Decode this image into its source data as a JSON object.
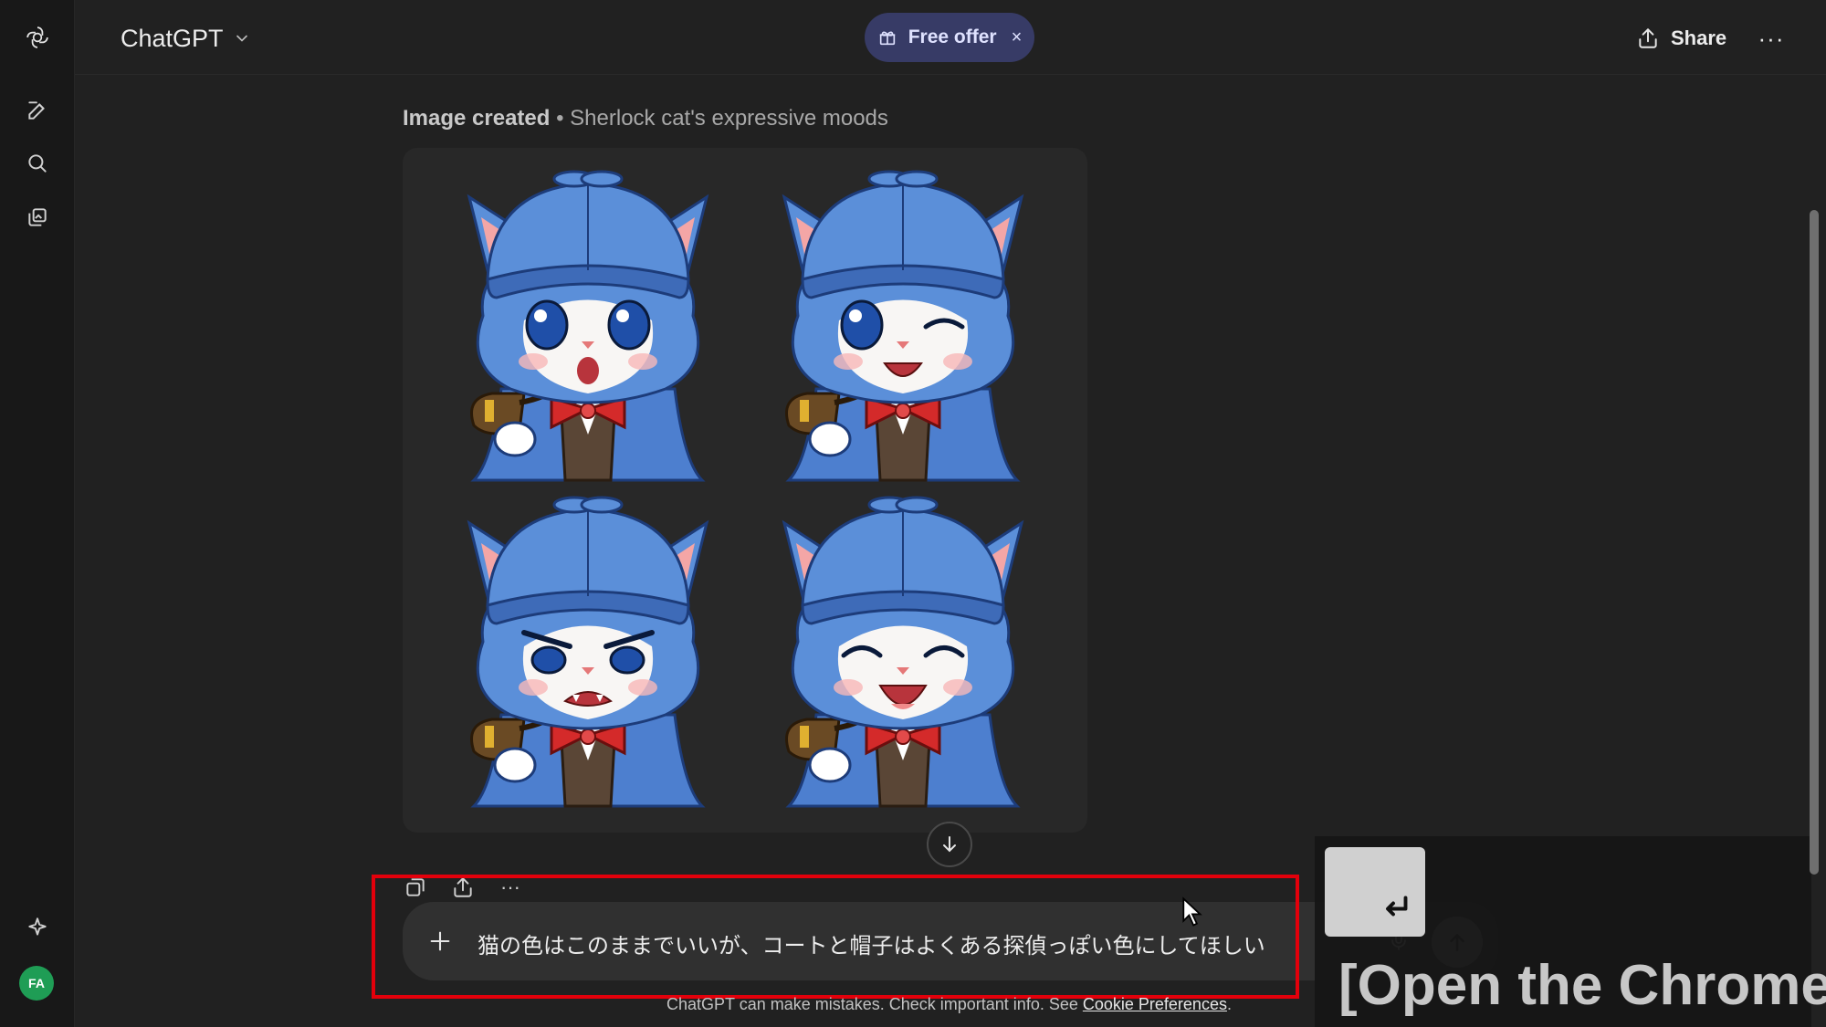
{
  "header": {
    "model_name": "ChatGPT",
    "offer_label": "Free offer",
    "offer_close": "×",
    "share_label": "Share",
    "more_label": "···"
  },
  "sidebar": {
    "icons": [
      "openai-logo-icon",
      "new-chat-icon",
      "search-icon",
      "library-icon",
      "explore-icon"
    ],
    "avatar_initials": "FA"
  },
  "message": {
    "caption_strong": "Image created",
    "caption_rest": " • Sherlock cat's expressive moods",
    "image_moods": [
      "surprised",
      "winking",
      "angry",
      "laughing"
    ]
  },
  "tools": {
    "more": "···"
  },
  "composer": {
    "text": "猫の色はこのままでいいが、コートと帽子はよくある探偵っぽい色にしてほしい"
  },
  "footer": {
    "disclaimer": "ChatGPT can make mistakes. Check important info. See ",
    "link": "Cookie Preferences",
    "tail": "."
  },
  "overlay": {
    "text": "[Open the Chrome"
  },
  "colors": {
    "background": "#212121",
    "rail": "#181818",
    "offer_bg": "#373b66",
    "highlight": "#e3000b",
    "cat_blue": "#5b8fd9",
    "bow_red": "#d42a2a"
  }
}
